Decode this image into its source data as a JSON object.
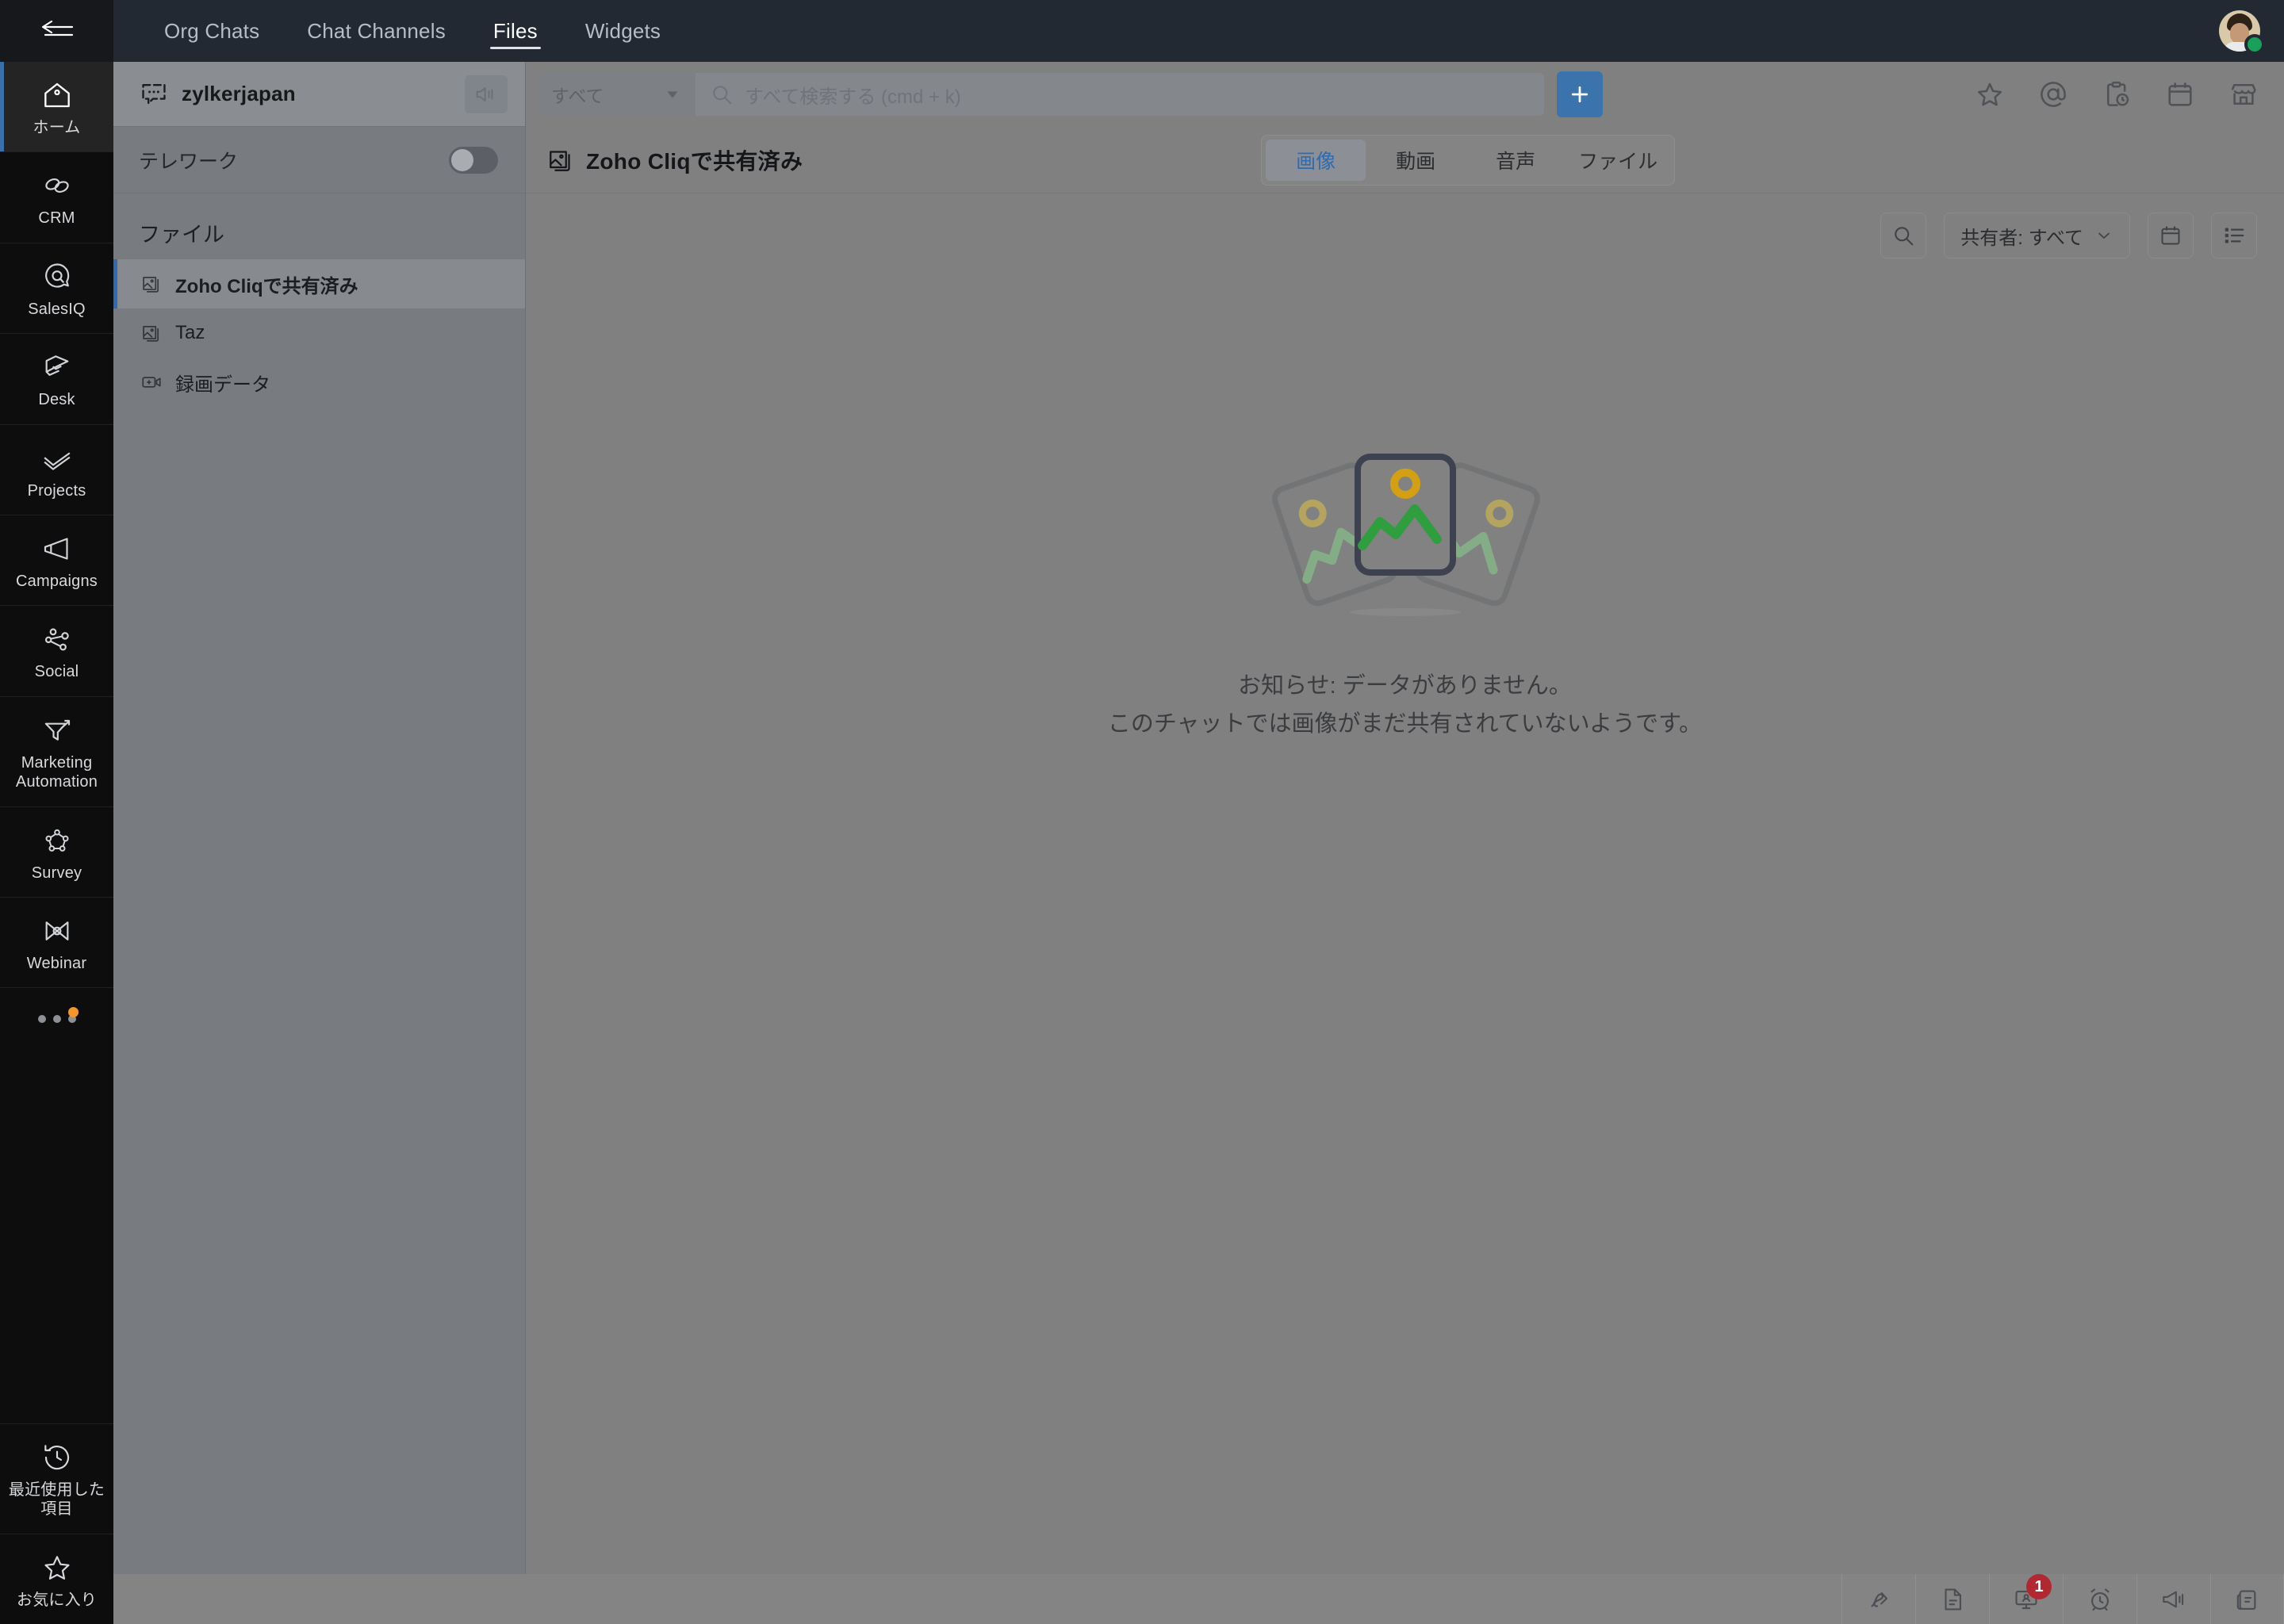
{
  "app_rail": {
    "collapse_label": "collapse-sidebar",
    "items": [
      {
        "label": "ホーム",
        "icon": "home-icon",
        "active": true
      },
      {
        "label": "CRM",
        "icon": "crm-icon",
        "active": false
      },
      {
        "label": "SalesIQ",
        "icon": "salesiq-icon",
        "active": false
      },
      {
        "label": "Desk",
        "icon": "desk-icon",
        "active": false
      },
      {
        "label": "Projects",
        "icon": "projects-icon",
        "active": false
      },
      {
        "label": "Campaigns",
        "icon": "campaigns-icon",
        "active": false
      },
      {
        "label": "Social",
        "icon": "social-icon",
        "active": false
      },
      {
        "label": "Marketing Automation",
        "icon": "marketing-automation-icon",
        "active": false
      },
      {
        "label": "Survey",
        "icon": "survey-icon",
        "active": false
      },
      {
        "label": "Webinar",
        "icon": "webinar-icon",
        "active": false
      }
    ],
    "more_icon": "more-dots-icon",
    "bottom_items": [
      {
        "label": "最近使用した項目",
        "icon": "history-clock-icon"
      },
      {
        "label": "お気に入り",
        "icon": "star-icon"
      }
    ]
  },
  "topnav": {
    "tabs": [
      {
        "label": "Org Chats",
        "active": false
      },
      {
        "label": "Chat Channels",
        "active": false
      },
      {
        "label": "Files",
        "active": true
      },
      {
        "label": "Widgets",
        "active": false
      }
    ],
    "avatar": "user-avatar",
    "status": "online"
  },
  "panel": {
    "chat_title": "zylkerjapan",
    "chat_icon": "chat-bubble-icon",
    "speaker_icon": "speaker-mute-icon",
    "toggle_row": {
      "label": "テレワーク",
      "state": "off"
    },
    "section_title": "ファイル",
    "items": [
      {
        "label": "Zoho Cliqで共有済み",
        "icon": "image-file-icon",
        "active": true
      },
      {
        "label": "Taz",
        "icon": "image-file-icon",
        "active": false
      },
      {
        "label": "録画データ",
        "icon": "recording-add-icon",
        "active": false
      }
    ]
  },
  "search": {
    "scope_label": "すべて",
    "placeholder": "すべて検索する (cmd + k)",
    "search_icon": "search-icon",
    "caret_icon": "chevron-down-icon",
    "add_label": "+"
  },
  "header_icons": [
    {
      "name": "star-icon"
    },
    {
      "name": "mention-icon"
    },
    {
      "name": "reminder-clipboard-icon"
    },
    {
      "name": "calendar-icon"
    },
    {
      "name": "marketplace-icon"
    }
  ],
  "content": {
    "title": "Zoho Cliqで共有済み",
    "title_icon": "image-file-icon",
    "tabs": [
      {
        "label": "画像",
        "active": true
      },
      {
        "label": "動画",
        "active": false
      },
      {
        "label": "音声",
        "active": false
      },
      {
        "label": "ファイル",
        "active": false
      }
    ],
    "filters": {
      "search_icon": "search-icon",
      "shared_by_label": "共有者: すべて",
      "shared_by_caret": "chevron-down-icon",
      "date_icon": "calendar-icon",
      "view_icon": "list-view-icon"
    },
    "empty_state": {
      "illustration": "empty-photos-illustration",
      "line1": "お知らせ: データがありません。",
      "line2": "このチャットでは画像がまだ共有されていないようです。"
    }
  },
  "bottombar": {
    "items": [
      {
        "name": "art-board-icon",
        "badge": ""
      },
      {
        "name": "document-icon",
        "badge": ""
      },
      {
        "name": "presentation-icon",
        "badge": "1"
      },
      {
        "name": "alarm-clock-icon",
        "badge": ""
      },
      {
        "name": "announcement-icon",
        "badge": ""
      },
      {
        "name": "notes-icon",
        "badge": ""
      }
    ]
  },
  "colors": {
    "rail_bg": "#0d0d0d",
    "topnav_bg": "#222932",
    "panel_bg": "#787c80",
    "main_bg": "#808080",
    "accent_blue": "#2f6bb0",
    "plus_blue": "#3b74ac",
    "badge_red": "#b22832",
    "online_green": "#19a05a",
    "notify_orange": "#f5962a"
  }
}
